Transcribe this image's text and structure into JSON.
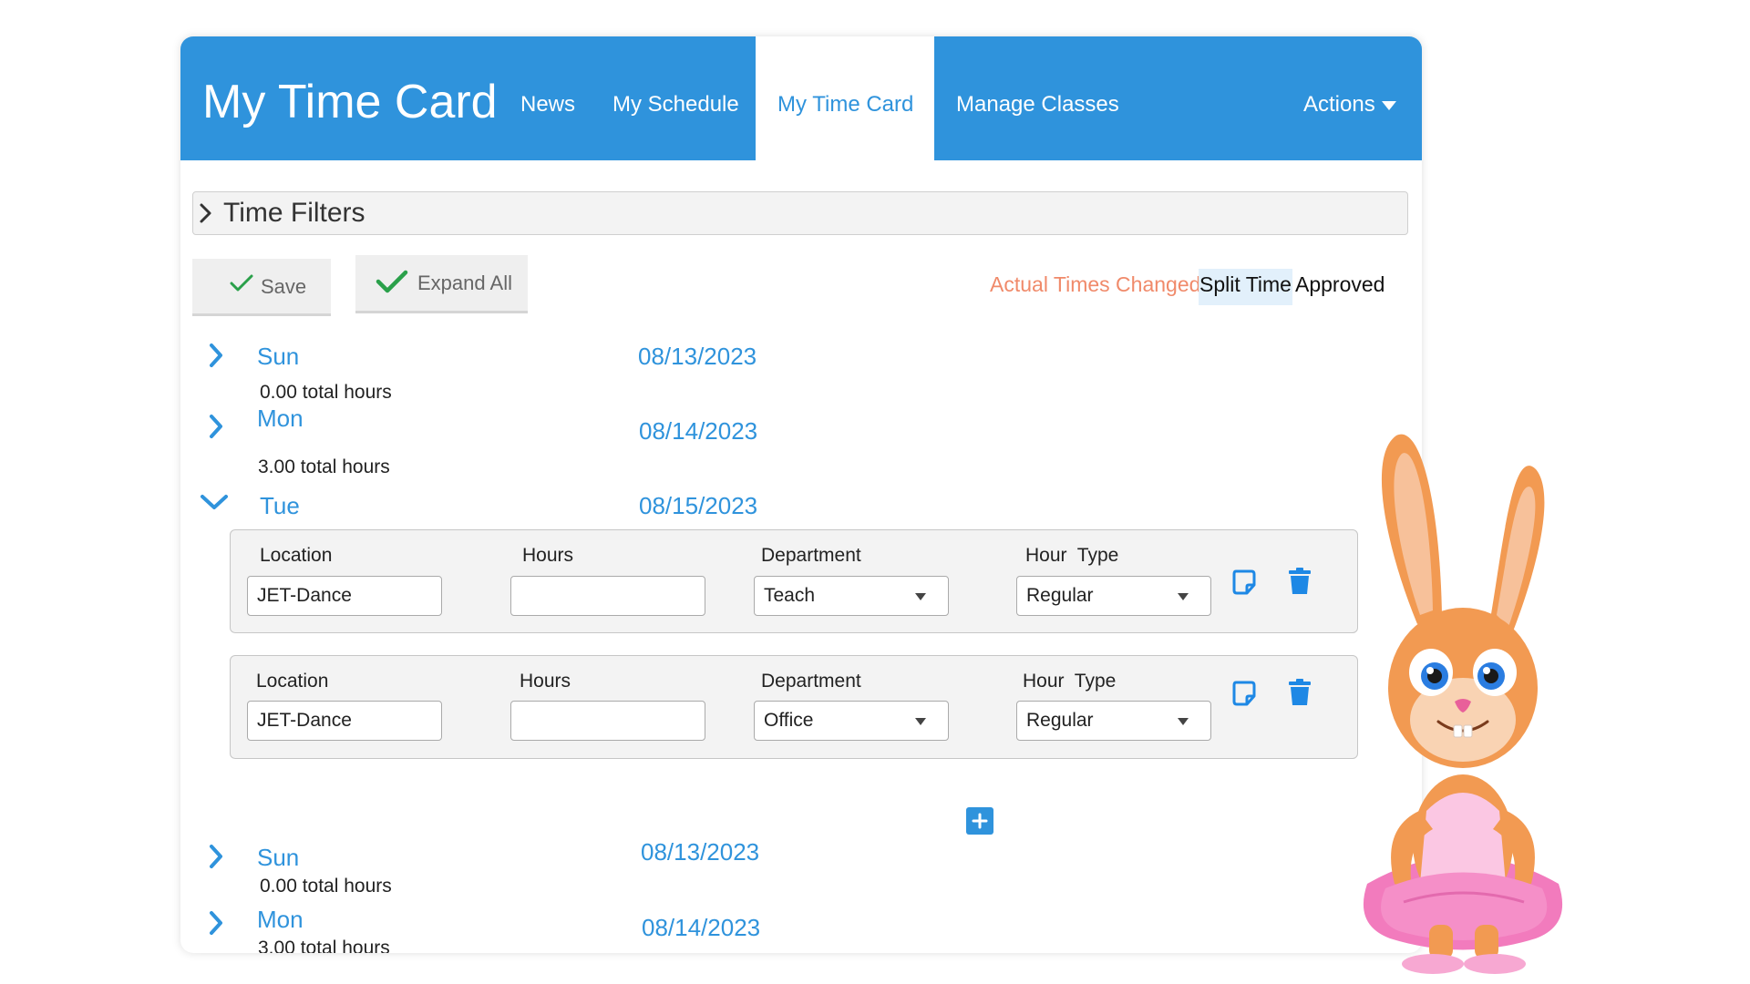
{
  "header": {
    "title": "My Time Card",
    "nav": [
      "News",
      "My Schedule",
      "My Time Card",
      "Manage Classes"
    ],
    "actions_label": "Actions"
  },
  "filters": {
    "label": "Time Filters"
  },
  "toolbar": {
    "save_label": "Save",
    "expand_label": "Expand All"
  },
  "legend": {
    "changed": "Actual Times Changed",
    "split": "Split Time",
    "approved": "Approved",
    "changed_color": "#f08a6a",
    "split_highlight": "#e2f0fb"
  },
  "days_top": [
    {
      "day": "Sun",
      "date": "08/13/2023",
      "hours": "0.00 total hours"
    },
    {
      "day": "Mon",
      "date": "08/14/2023",
      "hours": "3.00 total hours"
    }
  ],
  "expanded_day": {
    "day": "Tue",
    "date": "08/15/2023",
    "labels": {
      "location": "Location",
      "hours": "Hours",
      "department": "Department",
      "hour_type": "Hour  Type"
    },
    "entries": [
      {
        "location": "JET-Dance",
        "hours": "",
        "department": "Teach",
        "hour_type": "Regular"
      },
      {
        "location": "JET-Dance",
        "hours": "",
        "department": "Office",
        "hour_type": "Regular"
      }
    ]
  },
  "days_bottom": [
    {
      "day": "Sun",
      "date": "08/13/2023",
      "hours": "0.00 total hours"
    },
    {
      "day": "Mon",
      "date": "08/14/2023",
      "hours": "3.00 total hours"
    }
  ],
  "colors": {
    "brand": "#2f93dc",
    "check": "#2aa04a",
    "icon": "#1e88e5"
  },
  "icons": [
    "chevron-right-icon",
    "chevron-down-icon",
    "check-icon",
    "note-icon",
    "trash-icon",
    "plus-icon",
    "caret-down-icon"
  ]
}
